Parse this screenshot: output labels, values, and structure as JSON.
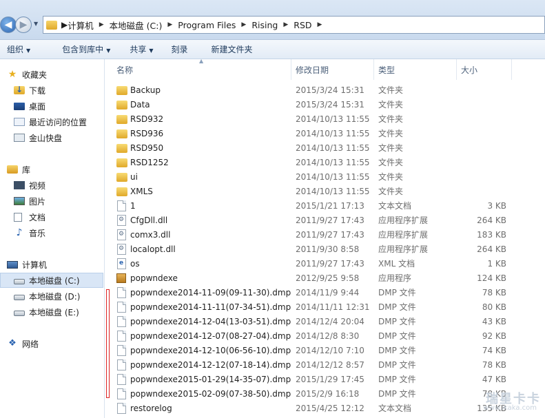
{
  "breadcrumb": [
    "计算机",
    "本地磁盘 (C:)",
    "Program Files",
    "Rising",
    "RSD"
  ],
  "commands": [
    {
      "label": "组织",
      "dropdown": true
    },
    {
      "label": "包含到库中",
      "dropdown": true
    },
    {
      "label": "共享",
      "dropdown": true
    },
    {
      "label": "刻录",
      "dropdown": false
    },
    {
      "label": "新建文件夹",
      "dropdown": false
    }
  ],
  "nav": {
    "favorites": "收藏夹",
    "downloads": "下载",
    "desktop": "桌面",
    "recent": "最近访问的位置",
    "kingsoft": "金山快盘",
    "libraries": "库",
    "videos": "视频",
    "pictures": "图片",
    "documents": "文档",
    "music": "音乐",
    "computer": "计算机",
    "drive_c": "本地磁盘 (C:)",
    "drive_d": "本地磁盘 (D:)",
    "drive_e": "本地磁盘 (E:)",
    "network": "网络"
  },
  "columns": {
    "name": "名称",
    "date": "修改日期",
    "type": "类型",
    "size": "大小"
  },
  "files": [
    {
      "name": "Backup",
      "date": "2015/3/24 15:31",
      "type": "文件夹",
      "size": "",
      "icon": "folder"
    },
    {
      "name": "Data",
      "date": "2015/3/24 15:31",
      "type": "文件夹",
      "size": "",
      "icon": "folder"
    },
    {
      "name": "RSD932",
      "date": "2014/10/13 11:55",
      "type": "文件夹",
      "size": "",
      "icon": "folder"
    },
    {
      "name": "RSD936",
      "date": "2014/10/13 11:55",
      "type": "文件夹",
      "size": "",
      "icon": "folder"
    },
    {
      "name": "RSD950",
      "date": "2014/10/13 11:55",
      "type": "文件夹",
      "size": "",
      "icon": "folder"
    },
    {
      "name": "RSD1252",
      "date": "2014/10/13 11:55",
      "type": "文件夹",
      "size": "",
      "icon": "folder"
    },
    {
      "name": "ui",
      "date": "2014/10/13 11:55",
      "type": "文件夹",
      "size": "",
      "icon": "folder"
    },
    {
      "name": "XMLS",
      "date": "2014/10/13 11:55",
      "type": "文件夹",
      "size": "",
      "icon": "folder"
    },
    {
      "name": "1",
      "date": "2015/1/21 17:13",
      "type": "文本文档",
      "size": "3 KB",
      "icon": "file"
    },
    {
      "name": "CfgDll.dll",
      "date": "2011/9/27 17:43",
      "type": "应用程序扩展",
      "size": "264 KB",
      "icon": "dll"
    },
    {
      "name": "comx3.dll",
      "date": "2011/9/27 17:43",
      "type": "应用程序扩展",
      "size": "183 KB",
      "icon": "dll"
    },
    {
      "name": "localopt.dll",
      "date": "2011/9/30 8:58",
      "type": "应用程序扩展",
      "size": "264 KB",
      "icon": "dll"
    },
    {
      "name": "os",
      "date": "2011/9/27 17:43",
      "type": "XML 文档",
      "size": "1 KB",
      "icon": "xml"
    },
    {
      "name": "popwndexe",
      "date": "2012/9/25 9:58",
      "type": "应用程序",
      "size": "124 KB",
      "icon": "exe"
    },
    {
      "name": "popwndexe2014-11-09(09-11-30).dmp",
      "date": "2014/11/9 9:44",
      "type": "DMP 文件",
      "size": "78 KB",
      "icon": "file"
    },
    {
      "name": "popwndexe2014-11-11(07-34-51).dmp",
      "date": "2014/11/11 12:31",
      "type": "DMP 文件",
      "size": "80 KB",
      "icon": "file"
    },
    {
      "name": "popwndexe2014-12-04(13-03-51).dmp",
      "date": "2014/12/4 20:04",
      "type": "DMP 文件",
      "size": "43 KB",
      "icon": "file"
    },
    {
      "name": "popwndexe2014-12-07(08-27-04).dmp",
      "date": "2014/12/8 8:30",
      "type": "DMP 文件",
      "size": "92 KB",
      "icon": "file"
    },
    {
      "name": "popwndexe2014-12-10(06-56-10).dmp",
      "date": "2014/12/10 7:10",
      "type": "DMP 文件",
      "size": "74 KB",
      "icon": "file"
    },
    {
      "name": "popwndexe2014-12-12(07-18-14).dmp",
      "date": "2014/12/12 8:57",
      "type": "DMP 文件",
      "size": "78 KB",
      "icon": "file"
    },
    {
      "name": "popwndexe2015-01-29(14-35-07).dmp",
      "date": "2015/1/29 17:45",
      "type": "DMP 文件",
      "size": "47 KB",
      "icon": "file"
    },
    {
      "name": "popwndexe2015-02-09(07-38-50).dmp",
      "date": "2015/2/9 16:18",
      "type": "DMP 文件",
      "size": "78 KB",
      "icon": "file"
    },
    {
      "name": "restorelog",
      "date": "2015/4/25 12:12",
      "type": "文本文档",
      "size": "135 KB",
      "icon": "file"
    }
  ],
  "watermark": {
    "main": "瑞星卡卡",
    "sub": "www.ikaka.com"
  }
}
